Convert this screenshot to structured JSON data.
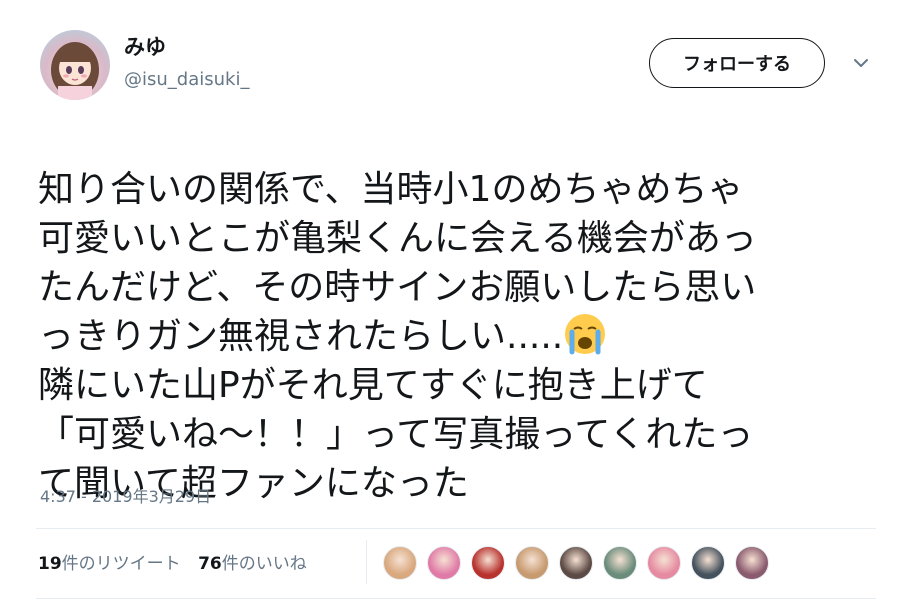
{
  "user": {
    "display_name": "みゆ",
    "handle": "@isu_daisuki_"
  },
  "follow_button": {
    "label": "フォローする"
  },
  "tweet": {
    "lines": [
      "知り合いの関係で、当時小1のめちゃめちゃ",
      "可愛いいとこが亀梨くんに会える機会があっ",
      "たんだけど、その時サインお願いしたら思い",
      "っきりガン無視されたらしい.....",
      "隣にいた山Pがそれ見てすぐに抱き上げて",
      "「可愛いね〜！！」って写真撮ってくれたっ",
      "て聞いて超ファンになった"
    ],
    "emoji": "crying-face"
  },
  "timestamp": "4:37 - 2019年3月29日",
  "stats": {
    "retweets": {
      "count": "19",
      "label": "件のリツイート"
    },
    "likes": {
      "count": "76",
      "label": "件のいいね"
    }
  },
  "likers": [
    {
      "color": "#d9a87e"
    },
    {
      "color": "#e07aa6"
    },
    {
      "color": "#b8322e"
    },
    {
      "color": "#c79a6f"
    },
    {
      "color": "#5c4a44"
    },
    {
      "color": "#6a8c7a"
    },
    {
      "color": "#e58aa0"
    },
    {
      "color": "#45525e"
    },
    {
      "color": "#8a5a6e"
    }
  ],
  "colors": {
    "text": "#14171a",
    "secondary": "#657786",
    "divider": "#e6ecf0"
  }
}
